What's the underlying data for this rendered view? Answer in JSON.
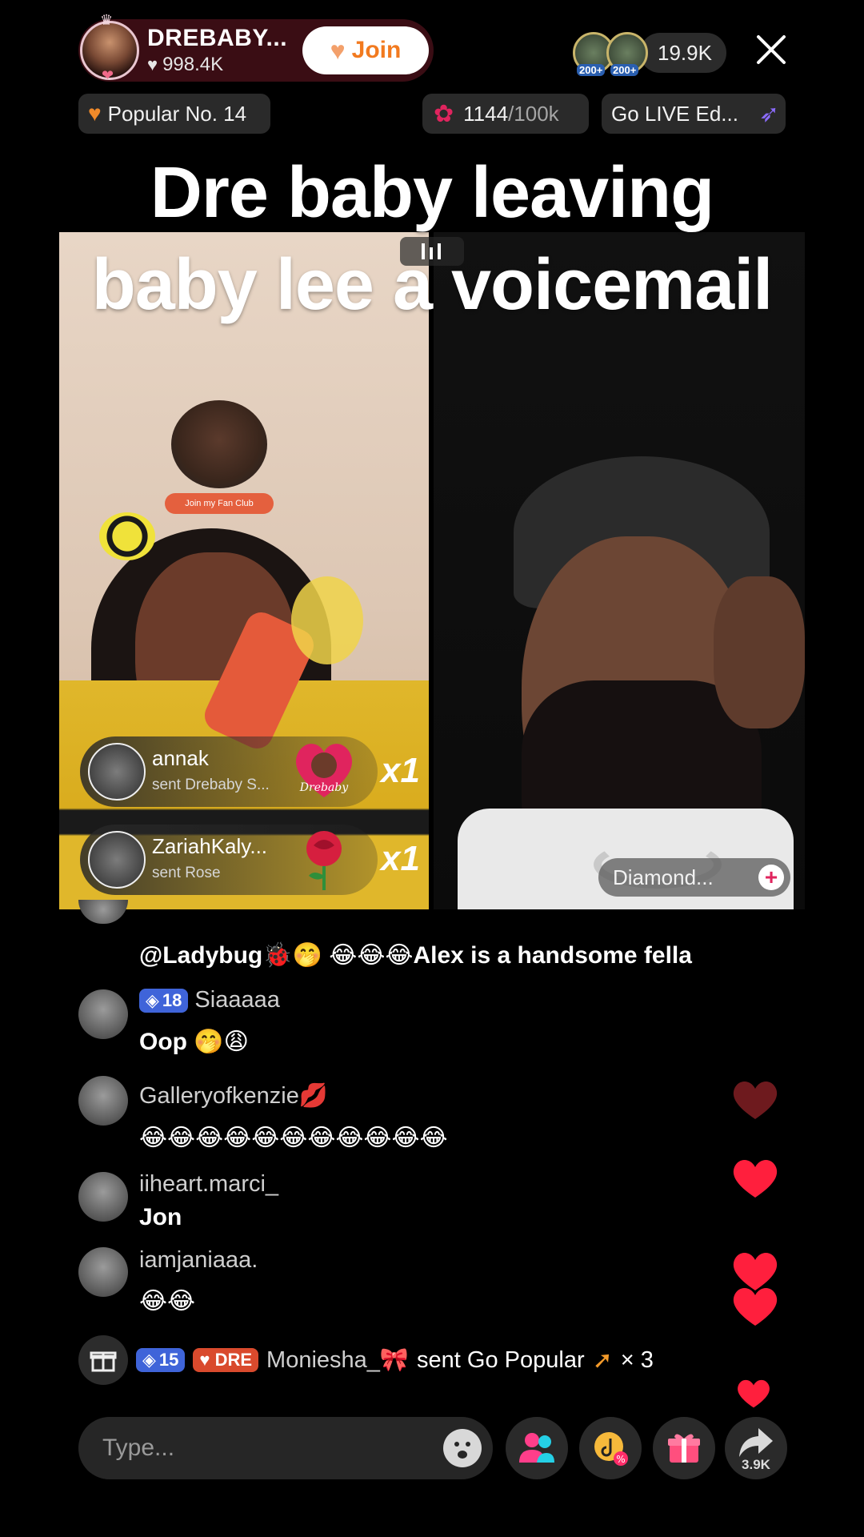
{
  "host": {
    "name": "DREBABY...",
    "likes": "998.4K",
    "join_label": "Join"
  },
  "viewers": {
    "badges": [
      "200+",
      "200+"
    ],
    "count": "19.9K"
  },
  "chips": {
    "popular": "Popular No. 14",
    "rose_count": "1144",
    "rose_goal": "/100k",
    "go_live": "Go LIVE Ed..."
  },
  "caption": {
    "line1": "Dre baby leaving",
    "line2": "baby lee a voicemail"
  },
  "left_panel": {
    "fan_club_label": "Join my Fan Club"
  },
  "gift_banners": [
    {
      "user": "annak",
      "action": "sent Drebaby S...",
      "multiplier": "x1",
      "icon": "drebaby-heart-gift-icon"
    },
    {
      "user": "ZariahKaly...",
      "action": "sent Rose",
      "multiplier": "x1",
      "icon": "rose-gift-icon"
    }
  ],
  "right_panel": {
    "name_pill": "Diamond..."
  },
  "chat": {
    "messages": [
      {
        "user": "",
        "text": "@Ladybug🐞🤭 😂😂😂Alex is a handsome fella"
      },
      {
        "user": "Siaaaaa",
        "level": "18",
        "text": "Oop 🤭😩"
      },
      {
        "user": "Galleryofkenzie💋",
        "text": "😂😂😂😂😂😂😂😂😂😂😂"
      },
      {
        "user": "iiheart.marci_",
        "text": "Jon"
      },
      {
        "user": "iamjaniaaa.",
        "text": "😂😂"
      }
    ],
    "gift_line": {
      "level": "15",
      "fan_badge": "DRE",
      "user": "Moniesha_🎀",
      "action": "sent Go Popular",
      "count": "× 3"
    }
  },
  "bottom_bar": {
    "input_placeholder": "Type...",
    "share_count": "3.9K"
  },
  "colors": {
    "heart_red": "#ff1f3d",
    "heart_dark": "#6e1a1e",
    "join_orange": "#f27a1f",
    "level_blue": "#3f64d9"
  }
}
